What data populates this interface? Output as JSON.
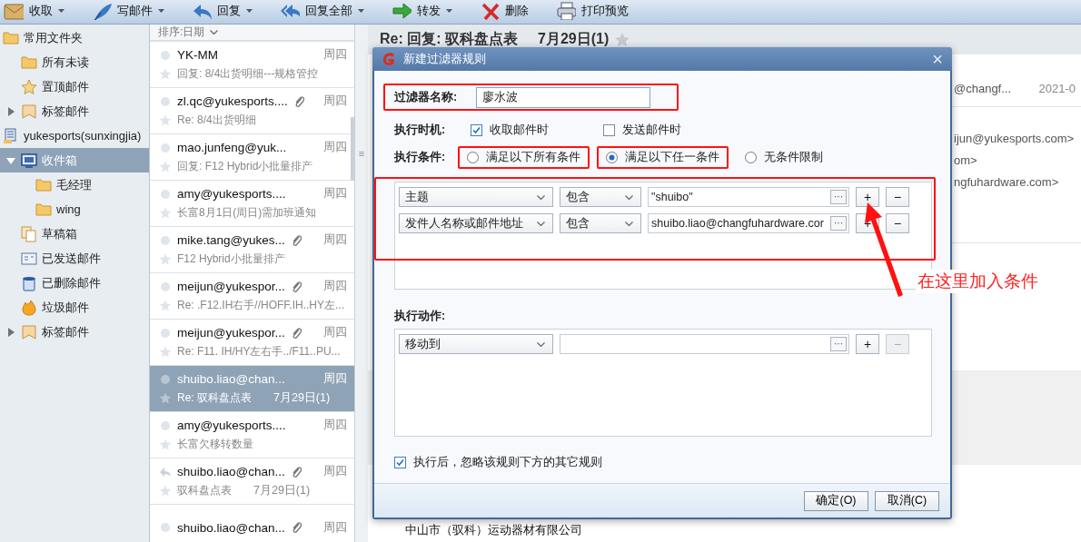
{
  "toolbar": [
    {
      "kind": "receive",
      "label": "收取",
      "menu": true
    },
    {
      "kind": "compose",
      "label": "写邮件",
      "menu": true
    },
    {
      "kind": "reply",
      "label": "回复",
      "menu": true
    },
    {
      "kind": "reply_all",
      "label": "回复全部",
      "menu": true
    },
    {
      "kind": "forward",
      "label": "转发",
      "menu": true
    },
    {
      "kind": "delete",
      "label": "删除",
      "menu": false
    },
    {
      "kind": "print",
      "label": "打印预览",
      "menu": false
    }
  ],
  "sidebar": {
    "items": [
      {
        "kind": "folder",
        "label": "常用文件夹",
        "selected": false,
        "children": [
          {
            "kind": "folder",
            "label": "所有未读",
            "selected": false
          },
          {
            "kind": "star",
            "label": "置顶邮件",
            "selected": false
          },
          {
            "kind": "tag",
            "label": "标签邮件",
            "selected": false,
            "expanded": false
          }
        ]
      },
      {
        "kind": "account",
        "label": "yukesports(sunxingjia)",
        "selected": false,
        "children": [
          {
            "kind": "inbox",
            "label": "收件箱",
            "selected": true,
            "expanded": true,
            "children": [
              {
                "kind": "folder",
                "label": "毛经理",
                "selected": false
              },
              {
                "kind": "folder",
                "label": "wing",
                "selected": false
              }
            ]
          },
          {
            "kind": "drafts",
            "label": "草稿箱",
            "selected": false
          },
          {
            "kind": "sent",
            "label": "已发送邮件",
            "selected": false
          },
          {
            "kind": "trash",
            "label": "已删除邮件",
            "selected": false
          },
          {
            "kind": "junk",
            "label": "垃圾邮件",
            "selected": false
          },
          {
            "kind": "tag",
            "label": "标签邮件",
            "selected": false,
            "expanded": false
          }
        ]
      }
    ]
  },
  "message_list": {
    "sort": "排序:日期",
    "splitter": "≡",
    "messages": [
      {
        "sender": "YK-MM",
        "subject": "回复: 8/4出货明细---规格管控",
        "day": "周四",
        "attachment": false,
        "replied": false,
        "selected": false
      },
      {
        "sender": "zl.qc@yukesports....",
        "subject": "Re: 8/4出货明细",
        "day": "周四",
        "attachment": true,
        "replied": false,
        "selected": false
      },
      {
        "sender": "mao.junfeng@yuk...",
        "subject": "回复: F12 Hybrid小批量排产",
        "day": "周四",
        "attachment": false,
        "replied": false,
        "selected": false
      },
      {
        "sender": "amy@yukesports....",
        "subject": "长富8月1日(周日)需加班通知",
        "day": "周四",
        "attachment": false,
        "replied": false,
        "selected": false
      },
      {
        "sender": "mike.tang@yukes...",
        "subject": "F12 Hybrid小批量排产",
        "day": "周四",
        "attachment": true,
        "replied": false,
        "selected": false
      },
      {
        "sender": "meijun@yukespor...",
        "subject": "Re: .F12.IH右手//HOFF.IH..HY左...",
        "day": "周四",
        "attachment": true,
        "replied": false,
        "selected": false
      },
      {
        "sender": "meijun@yukespor...",
        "subject": "Re: F11.  IH/HY左右手../F11..PU...",
        "day": "周四",
        "attachment": true,
        "replied": false,
        "selected": false
      },
      {
        "sender": "shuibo.liao@chan...",
        "subject": "Re: 驭科盘点表",
        "date": "7月29日(1)",
        "day": "周四",
        "attachment": false,
        "replied": false,
        "selected": true
      },
      {
        "sender": "amy@yukesports....",
        "subject": "长富欠移转数量",
        "day": "周四",
        "attachment": false,
        "replied": false,
        "selected": false
      },
      {
        "sender": "shuibo.liao@chan...",
        "subject": "驭科盘点表",
        "date": "7月29日(1)",
        "day": "周四",
        "attachment": true,
        "replied": true,
        "selected": false
      },
      {
        "sender": "shuibo.liao@chan...",
        "day": "周四",
        "attachment": true,
        "replied": false,
        "selected": false
      }
    ]
  },
  "reading_pane": {
    "subject": "Re: 回复: 驭科盘点表",
    "date": "7月29日(1)",
    "starred": false,
    "lines": [
      {
        "text": "@changf...",
        "aside": "2021-0"
      },
      {
        "text": "ijun@yukesports.com>"
      },
      {
        "text": "om>"
      },
      {
        "text": "ngfuhardware.com>"
      }
    ],
    "footer": "中山市（驭科）运动器材有限公司"
  },
  "dialog": {
    "title": "新建过滤器规则",
    "close": "×",
    "name": {
      "label": "过滤器名称:",
      "value": "廖水波",
      "highlighted": true
    },
    "timing": {
      "label": "执行时机:",
      "options": [
        {
          "label": "收取邮件时",
          "checked": true
        },
        {
          "label": "发送邮件时",
          "checked": false
        }
      ]
    },
    "condition_mode": {
      "label": "执行条件:",
      "options": [
        {
          "label": "满足以下所有条件",
          "selected": false,
          "highlighted": true
        },
        {
          "label": "满足以下任一条件",
          "selected": true,
          "highlighted": true
        },
        {
          "label": "无条件限制",
          "selected": false,
          "highlighted": false
        }
      ]
    },
    "conditions": {
      "highlighted": true,
      "rows": [
        {
          "field": "主题",
          "operator": "包含",
          "value": "\"shuibo\"",
          "browse": "···",
          "add": "+",
          "remove": "−",
          "remove_disabled": false
        },
        {
          "field": "发件人名称或邮件地址",
          "operator": "包含",
          "value": "shuibo.liao@changfuhardware.cor",
          "browse": "···",
          "add": "+",
          "remove": "−",
          "remove_disabled": false
        }
      ]
    },
    "actions": {
      "label": "执行动作:",
      "rows": [
        {
          "action": "移动到",
          "browse": "···",
          "add": "+",
          "remove": "−",
          "remove_disabled": true
        }
      ]
    },
    "stop_after": {
      "label": "执行后，忽略该规则下方的其它规则",
      "checked": true
    },
    "buttons": [
      {
        "label": "确定(O)"
      },
      {
        "label": "取消(C)"
      }
    ]
  },
  "annotation": {
    "text": "在这里加入条件"
  }
}
